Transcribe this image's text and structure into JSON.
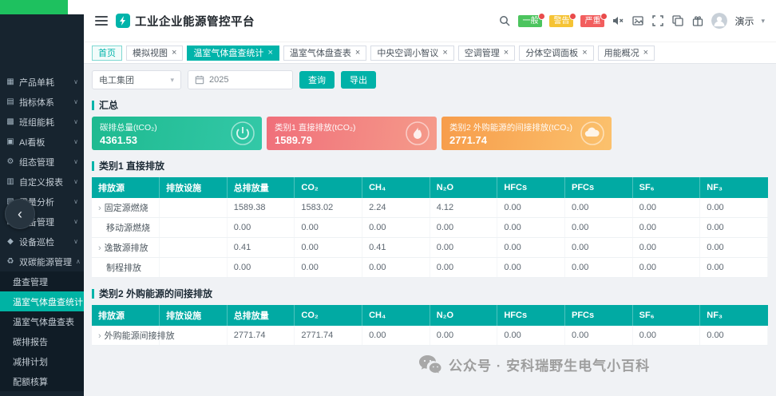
{
  "app": {
    "title": "工业企业能源管控平台",
    "user": "演示"
  },
  "theme": {
    "accent": "#00b4aa",
    "sidebar_bg": "#17242f",
    "table_header": "#01aaa3",
    "strip_green": "#1ec15f",
    "badge_colors": {
      "general": "#4cc45e",
      "warning": "#f5c334",
      "critical": "#f25e5e"
    },
    "card_gradients": {
      "total": [
        "#1eba90",
        "#33c8a7"
      ],
      "direct": [
        "#f06f7a",
        "#f59b8a"
      ],
      "indirect": [
        "#f79d4b",
        "#fbc16d"
      ]
    }
  },
  "icons": {
    "collapse": "‹",
    "chevron_down": "∨",
    "chevron_up": "∧",
    "select_caret": "▾",
    "row_expand": "›",
    "tab_close": "×"
  },
  "topbar": {
    "badges": [
      {
        "label": "一般"
      },
      {
        "label": "警告"
      },
      {
        "label": "严重"
      }
    ]
  },
  "sidebar": {
    "items": [
      {
        "label": "产品单耗",
        "icon": "▦"
      },
      {
        "label": "指标体系",
        "icon": "▤"
      },
      {
        "label": "班组能耗",
        "icon": "▩"
      },
      {
        "label": "AI看板",
        "icon": "▣"
      },
      {
        "label": "组态管理",
        "icon": "⚙"
      },
      {
        "label": "自定义报表",
        "icon": "▥"
      },
      {
        "label": "需量分析",
        "icon": "▧"
      },
      {
        "label": "设备管理",
        "icon": "▨"
      },
      {
        "label": "设备巡检",
        "icon": "◆"
      },
      {
        "label": "双碳能源管理",
        "icon": "♻"
      },
      {
        "label": "盘查管理"
      },
      {
        "label": "温室气体盘查统计"
      },
      {
        "label": "温室气体盘查表"
      },
      {
        "label": "碳排报告"
      },
      {
        "label": "减排计划"
      },
      {
        "label": "配额核算"
      }
    ]
  },
  "tabs": [
    {
      "label": "首页"
    },
    {
      "label": "模拟视图"
    },
    {
      "label": "温室气体盘查统计"
    },
    {
      "label": "温室气体盘查表"
    },
    {
      "label": "中央空调小智议"
    },
    {
      "label": "空调管理"
    },
    {
      "label": "分体空调面板"
    },
    {
      "label": "用能概况"
    }
  ],
  "filters": {
    "org": "电工集团",
    "year": "2025",
    "query_label": "查询",
    "export_label": "导出"
  },
  "summary": {
    "title": "汇总",
    "cards": [
      {
        "title": "碳排总量(tCO₂)",
        "value": "4361.53"
      },
      {
        "title": "类别1 直接排放(tCO₂)",
        "value": "1589.79"
      },
      {
        "title": "类别2 外购能源的间接排放(tCO₂)",
        "value": "2771.74"
      }
    ]
  },
  "tables": [
    {
      "title": "类别1 直接排放",
      "headers": [
        "排放源",
        "排放设施",
        "总排放量",
        "CO₂",
        "CH₄",
        "N₂O",
        "HFCs",
        "PFCs",
        "SF₆",
        "NF₃"
      ],
      "rows": [
        {
          "name": "固定源燃烧",
          "values": [
            "",
            "1589.38",
            "1583.02",
            "2.24",
            "4.12",
            "0.00",
            "0.00",
            "0.00",
            "0.00"
          ]
        },
        {
          "name": "移动源燃烧",
          "values": [
            "",
            "0.00",
            "0.00",
            "0.00",
            "0.00",
            "0.00",
            "0.00",
            "0.00",
            "0.00"
          ]
        },
        {
          "name": "逸散源排放",
          "values": [
            "",
            "0.41",
            "0.00",
            "0.41",
            "0.00",
            "0.00",
            "0.00",
            "0.00",
            "0.00"
          ]
        },
        {
          "name": "制程排放",
          "values": [
            "",
            "0.00",
            "0.00",
            "0.00",
            "0.00",
            "0.00",
            "0.00",
            "0.00",
            "0.00"
          ]
        }
      ]
    },
    {
      "title": "类别2 外购能源的间接排放",
      "headers": [
        "排放源",
        "排放设施",
        "总排放量",
        "CO₂",
        "CH₄",
        "N₂O",
        "HFCs",
        "PFCs",
        "SF₆",
        "NF₃"
      ],
      "rows": [
        {
          "name": "外购能源间接排放",
          "values": [
            "",
            "2771.74",
            "2771.74",
            "0.00",
            "0.00",
            "0.00",
            "0.00",
            "0.00",
            "0.00"
          ]
        }
      ]
    }
  ],
  "watermark": {
    "text": "公众号 · 安科瑞野生电气小百科"
  }
}
